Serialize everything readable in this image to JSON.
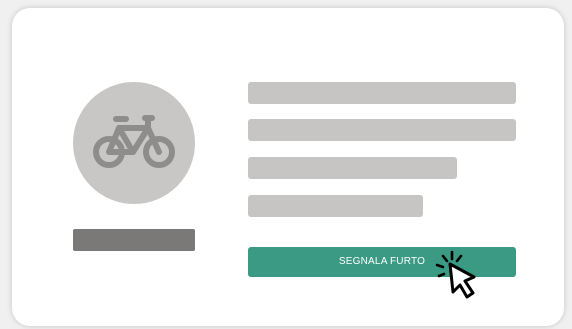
{
  "card": {
    "icon": "bicycle-icon",
    "report_button_label": "SEGNALA FURTO"
  },
  "colors": {
    "placeholder": "#c6c5c4",
    "avatar_background": "#c8c7c6",
    "name_bar": "#7a7978",
    "button": "#3a9a84",
    "button_text": "#ffffff"
  },
  "cursor": {
    "icon": "pointer-click-icon"
  }
}
